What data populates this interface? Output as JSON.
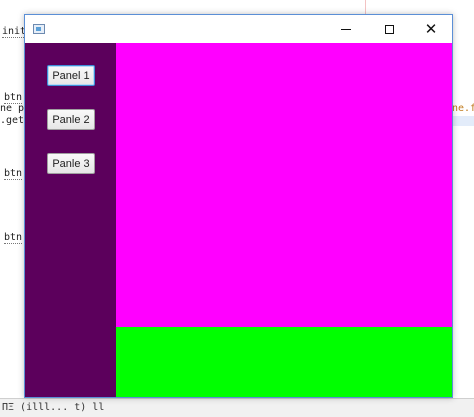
{
  "editor": {
    "lines": [
      "init",
      "btn",
      "ne p",
      ".get",
      "ne.f",
      "btn",
      "btn"
    ],
    "status_text": "ΠΞ (illl... t) ll"
  },
  "window": {
    "title": "",
    "controls": {
      "minimize": "minimize",
      "maximize": "maximize",
      "close": "✕"
    }
  },
  "sidebar": {
    "buttons": [
      {
        "label": "Panel 1",
        "focused": true
      },
      {
        "label": "Panle 2",
        "focused": false
      },
      {
        "label": "Panle 3",
        "focused": false
      }
    ]
  },
  "colors": {
    "sidebar": "#5c005c",
    "main_panel": "#ff00ff",
    "bottom_panel": "#00ff00",
    "window_border": "#5b8fd6"
  }
}
